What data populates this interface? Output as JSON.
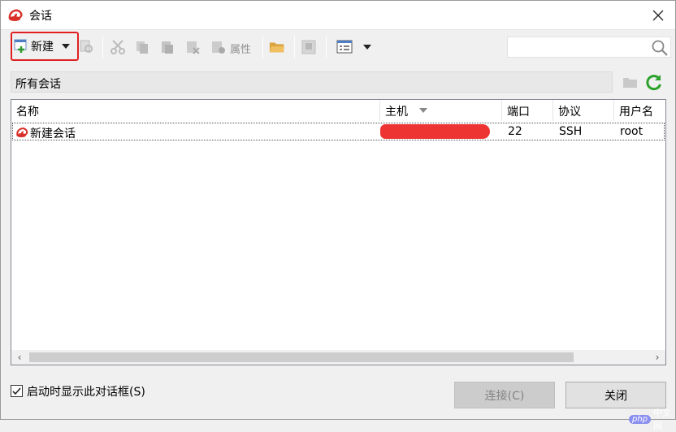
{
  "window": {
    "title": "会话"
  },
  "toolbar": {
    "new_label": "新建",
    "properties_label": "属性",
    "search_placeholder": ""
  },
  "path": {
    "current": "所有会话"
  },
  "table": {
    "columns": [
      "名称",
      "主机",
      "端口",
      "协议",
      "用户名"
    ],
    "rows": [
      {
        "name": "新建会话",
        "host": "",
        "port": "22",
        "protocol": "SSH",
        "user": "root"
      }
    ]
  },
  "footer": {
    "show_on_start_label": "启动时显示此对话框(S)",
    "show_on_start_checked": true,
    "connect_label": "连接(C)",
    "close_label": "关闭"
  },
  "watermark": {
    "logo": "php",
    "text": "中文网"
  },
  "colors": {
    "accent_red": "#e02020",
    "refresh_green": "#2aa12a",
    "redaction": "#ee3333"
  }
}
